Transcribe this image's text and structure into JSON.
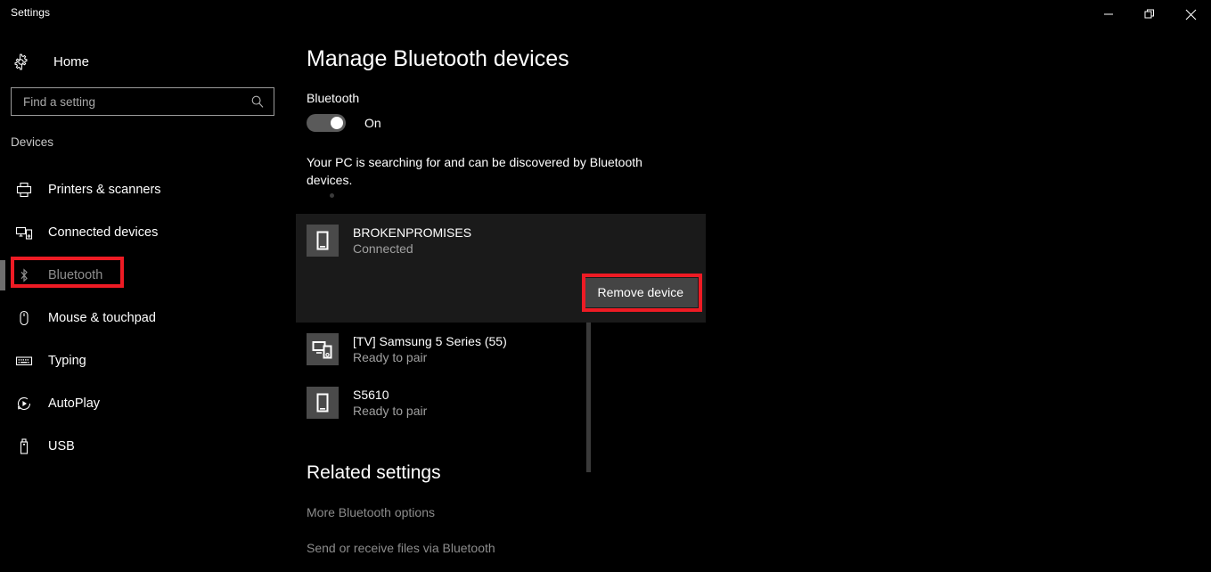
{
  "window": {
    "title": "Settings",
    "controls": [
      {
        "name": "minimize",
        "glyph": "minimize-icon"
      },
      {
        "name": "maximize",
        "glyph": "restore-icon"
      },
      {
        "name": "close",
        "glyph": "close-icon"
      }
    ]
  },
  "sidebar": {
    "home_label": "Home",
    "home_icon": "gear-icon",
    "search": {
      "placeholder": "Find a setting",
      "value": "",
      "icon": "search-icon"
    },
    "section_label": "Devices",
    "items": [
      {
        "label": "Printers & scanners",
        "icon": "printer-icon",
        "selected": false
      },
      {
        "label": "Connected devices",
        "icon": "connected-devices-icon",
        "selected": false
      },
      {
        "label": "Bluetooth",
        "icon": "bluetooth-icon",
        "selected": true
      },
      {
        "label": "Mouse & touchpad",
        "icon": "mouse-icon",
        "selected": false
      },
      {
        "label": "Typing",
        "icon": "keyboard-icon",
        "selected": false
      },
      {
        "label": "AutoPlay",
        "icon": "autoplay-icon",
        "selected": false
      },
      {
        "label": "USB",
        "icon": "usb-icon",
        "selected": false
      }
    ]
  },
  "main": {
    "page_title": "Manage Bluetooth devices",
    "bluetooth_label": "Bluetooth",
    "toggle_state": "On",
    "search_status": "Your PC is searching for and can be discovered by Bluetooth devices.",
    "devices": [
      {
        "name": "BROKENPROMISES",
        "status": "Connected",
        "icon": "phone-icon",
        "selected": true,
        "action_label": "Remove device"
      },
      {
        "name": "[TV] Samsung 5 Series (55)",
        "status": "Ready to pair",
        "icon": "tv-icon",
        "selected": false
      },
      {
        "name": "S5610",
        "status": "Ready to pair",
        "icon": "phone-icon",
        "selected": false
      }
    ],
    "related": {
      "title": "Related settings",
      "links": [
        "More Bluetooth options",
        "Send or receive files via Bluetooth"
      ]
    }
  },
  "highlight_color": "#ee1b24"
}
